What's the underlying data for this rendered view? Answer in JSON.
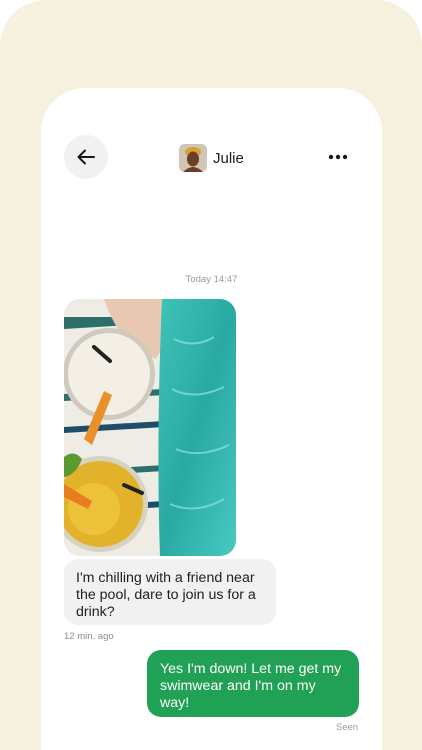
{
  "header": {
    "back_icon": "arrow-left-icon",
    "contact_name": "Julie",
    "more_icon": "more-horizontal-icon"
  },
  "conversation": {
    "timestamp": "Today 14:47",
    "incoming": {
      "image": "pool-drinks-photo",
      "text": "I'm chilling with a friend near the pool, dare to join us for a drink?",
      "time": "12 min. ago"
    },
    "outgoing": {
      "text": "Yes I'm down!  Let me get my swimwear and I'm on my way!",
      "status": "Seen"
    }
  },
  "colors": {
    "background": "#f6f0df",
    "outgoing_bubble": "#21a155",
    "incoming_bubble": "#f1f1f1"
  }
}
